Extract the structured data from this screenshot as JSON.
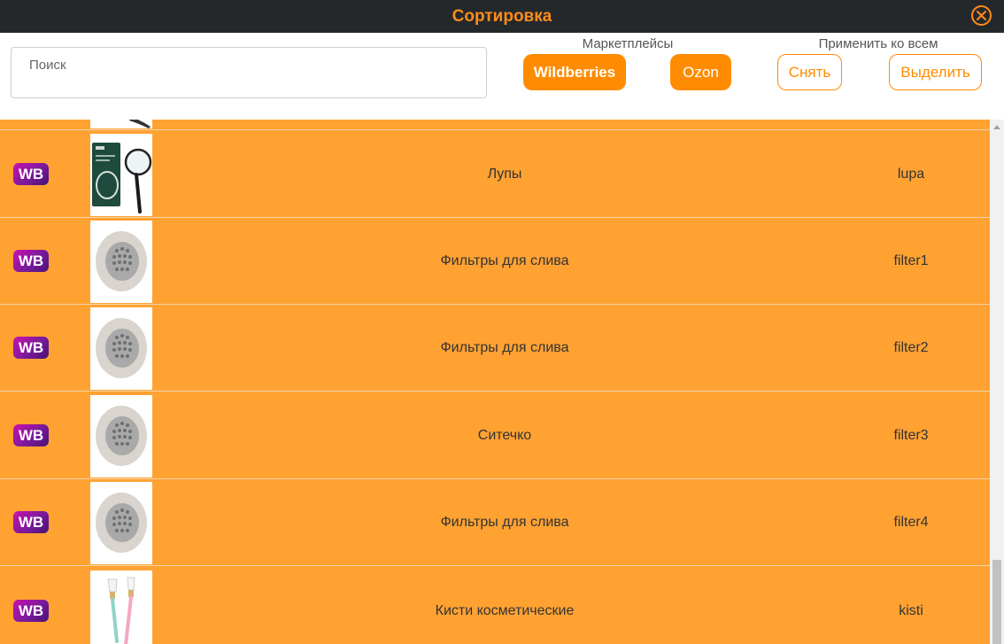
{
  "header": {
    "title": "Сортировка",
    "close_icon": "close-circle-icon"
  },
  "toolbar": {
    "search_placeholder": "Поиск",
    "marketplaces_label": "Маркетплейсы",
    "wildberries_label": "Wildberries",
    "ozon_label": "Ozon",
    "apply_all_label": "Применить ко всем",
    "unselect_label": "Снять",
    "select_label": "Выделить"
  },
  "colors": {
    "accent": "#ff8c00",
    "row_bg": "#ffa232",
    "titlebar_bg": "#25282b",
    "wb_badge": "#cb11ab"
  },
  "items": [
    {
      "badge": "WB",
      "name": "Лупы",
      "code": "lupa",
      "image": "magnifier-product-icon"
    },
    {
      "badge": "WB",
      "name": "Фильтры для слива",
      "code": "filter1",
      "image": "drain-filter-product-icon"
    },
    {
      "badge": "WB",
      "name": "Фильтры для слива",
      "code": "filter2",
      "image": "drain-filter-product-icon"
    },
    {
      "badge": "WB",
      "name": "Ситечко",
      "code": "filter3",
      "image": "drain-filter-product-icon"
    },
    {
      "badge": "WB",
      "name": "Фильтры для слива",
      "code": "filter4",
      "image": "drain-filter-product-icon"
    },
    {
      "badge": "WB",
      "name": "Кисти косметические",
      "code": "kisti",
      "image": "cosmetic-brushes-product-icon"
    }
  ]
}
